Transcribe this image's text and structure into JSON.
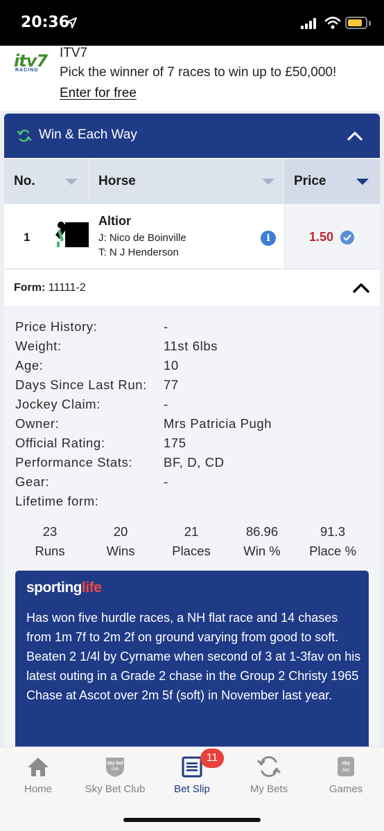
{
  "status_bar": {
    "time": "20:36"
  },
  "promo": {
    "logo_main": "itv7",
    "logo_sub": "RACING",
    "title": "ITV7",
    "text": "Pick the winner of 7 races to win up to £50,000!",
    "link": "Enter for free"
  },
  "market": {
    "title": "Win & Each Way"
  },
  "columns": {
    "no": "No.",
    "horse": "Horse",
    "price": "Price"
  },
  "runner": {
    "number": "1",
    "name": "Altior",
    "jockey": "J: Nico de Boinville",
    "trainer": "T: N J Henderson",
    "info": "i",
    "price": "1.50"
  },
  "form": {
    "label": "Form:",
    "value": "11111-2"
  },
  "details": [
    {
      "label": "Price History:",
      "value": "-"
    },
    {
      "label": "Weight:",
      "value": "11st 6lbs"
    },
    {
      "label": "Age:",
      "value": "10"
    },
    {
      "label": "Days Since Last Run:",
      "value": "77"
    },
    {
      "label": "Jockey Claim:",
      "value": "-"
    },
    {
      "label": "Owner:",
      "value": "Mrs Patricia Pugh"
    },
    {
      "label": "Official Rating:",
      "value": "175"
    },
    {
      "label": "Performance Stats:",
      "value": "BF, D, CD"
    },
    {
      "label": "Gear:",
      "value": "-"
    },
    {
      "label": "Lifetime form:",
      "value": ""
    }
  ],
  "stats": [
    {
      "value": "23",
      "label": "Runs"
    },
    {
      "value": "20",
      "label": "Wins"
    },
    {
      "value": "21",
      "label": "Places"
    },
    {
      "value": "86.96",
      "label": "Win %"
    },
    {
      "value": "91.3",
      "label": "Place %"
    }
  ],
  "sporting_life": {
    "logo_a": "sporting",
    "logo_b": "life",
    "text": "Has won five hurdle races, a NH flat race and 14 chases from 1m 7f to 2m 2f on ground varying from good to soft. Beaten 2 1/4l by Cyrname when second of 3 at 1-3fav on his latest outing in a Grade 2 chase in the Group 2 Christy 1965 Chase at Ascot over 2m 5f (soft) in November last year."
  },
  "tabs": [
    {
      "label": "Home",
      "icon": "home-icon"
    },
    {
      "label": "Sky Bet Club",
      "icon": "sky-bet-club-icon"
    },
    {
      "label": "Bet Slip",
      "icon": "bet-slip-icon",
      "active": true
    },
    {
      "label": "My Bets",
      "icon": "my-bets-icon"
    },
    {
      "label": "Games",
      "icon": "games-icon"
    }
  ],
  "bet_slip_badge": "11",
  "colors": {
    "brand_navy": "#1f3a86",
    "price_red": "#c4232f",
    "badge_red": "#e8403b",
    "itv_green": "#3f8f2a"
  }
}
